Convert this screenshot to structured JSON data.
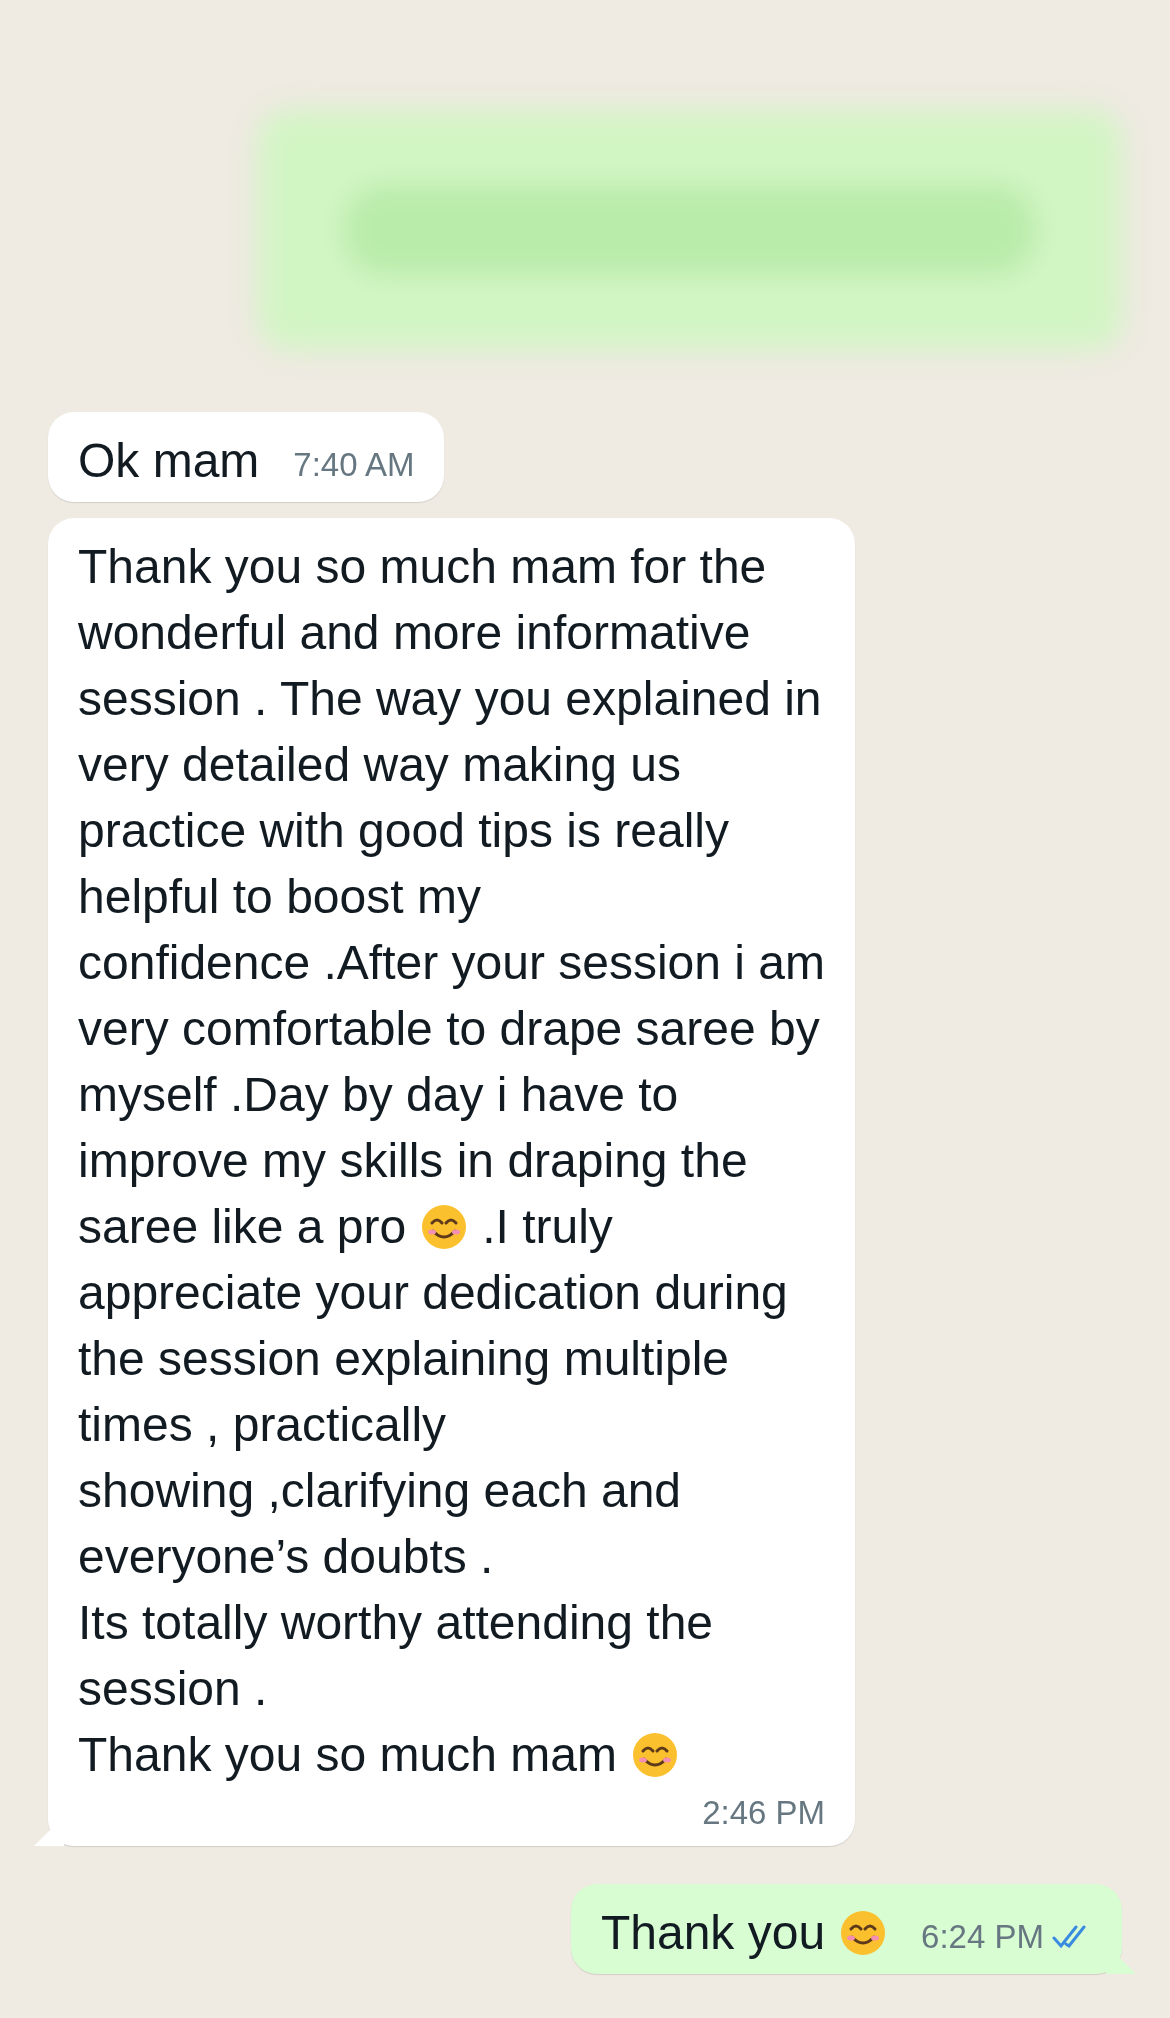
{
  "messages": [
    {
      "kind": "incoming",
      "lines": [
        [
          {
            "kind": "text",
            "text": "Ok mam"
          }
        ]
      ],
      "time": "7:40 AM"
    },
    {
      "kind": "incoming",
      "lines": [
        [
          {
            "kind": "text",
            "text": "Thank you so much mam for the"
          }
        ],
        [
          {
            "kind": "text",
            "text": "wonderful and more informative"
          }
        ],
        [
          {
            "kind": "text",
            "text": "session . The way you explained in"
          }
        ],
        [
          {
            "kind": "text",
            "text": "very detailed way making us"
          }
        ],
        [
          {
            "kind": "text",
            "text": "practice with good tips is really"
          }
        ],
        [
          {
            "kind": "text",
            "text": "helpful to boost my"
          }
        ],
        [
          {
            "kind": "text",
            "text": "confidence .After your session i am"
          }
        ],
        [
          {
            "kind": "text",
            "text": "very comfortable to drape saree by"
          }
        ],
        [
          {
            "kind": "text",
            "text": "myself .Day by day i have to"
          }
        ],
        [
          {
            "kind": "text",
            "text": "improve my skills in draping the"
          }
        ],
        [
          {
            "kind": "text",
            "text": "saree like a pro"
          },
          {
            "kind": "emoji"
          },
          {
            "kind": "text",
            "text": ".I truly"
          }
        ],
        [
          {
            "kind": "text",
            "text": "appreciate your dedication during"
          }
        ],
        [
          {
            "kind": "text",
            "text": "the session explaining multiple"
          }
        ],
        [
          {
            "kind": "text",
            "text": "times , practically"
          }
        ],
        [
          {
            "kind": "text",
            "text": "showing ,clarifying each and"
          }
        ],
        [
          {
            "kind": "text",
            "text": "everyone’s doubts ."
          }
        ],
        [
          {
            "kind": "text",
            "text": "Its totally worthy attending the"
          }
        ],
        [
          {
            "kind": "text",
            "text": "session ."
          }
        ],
        [
          {
            "kind": "text",
            "text": "Thank you so much mam"
          },
          {
            "kind": "emoji"
          }
        ]
      ],
      "time": "2:46 PM"
    },
    {
      "kind": "outgoing",
      "lines": [
        [
          {
            "kind": "text",
            "text": "Thank you"
          },
          {
            "kind": "emoji"
          }
        ]
      ],
      "time": "6:24 PM",
      "read": true
    }
  ]
}
